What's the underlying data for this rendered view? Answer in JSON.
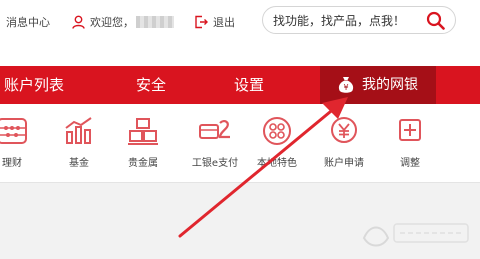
{
  "header": {
    "messages_label": "消息中心",
    "welcome_label": "欢迎您，",
    "logout_label": "退出",
    "search_placeholder": "找功能，找产品，点我！"
  },
  "nav": {
    "items": [
      {
        "label": "账户列表"
      },
      {
        "label": "安全"
      },
      {
        "label": "设置"
      },
      {
        "label": "我的网银"
      }
    ]
  },
  "tools": [
    {
      "label": "理财",
      "icon": "abacus-icon"
    },
    {
      "label": "基金",
      "icon": "fund-chart-icon"
    },
    {
      "label": "贵金属",
      "icon": "gold-bars-icon"
    },
    {
      "label": "工银e支付",
      "icon": "e-pay-card-icon"
    },
    {
      "label": "本地特色",
      "icon": "local-feature-icon"
    },
    {
      "label": "账户申请",
      "icon": "yuan-coin-icon"
    },
    {
      "label": "调整",
      "icon": "plus-box-icon"
    }
  ],
  "colors": {
    "brand_red": "#d9141f",
    "active_nav": "#a50f17",
    "icon_red": "#e0555b"
  }
}
